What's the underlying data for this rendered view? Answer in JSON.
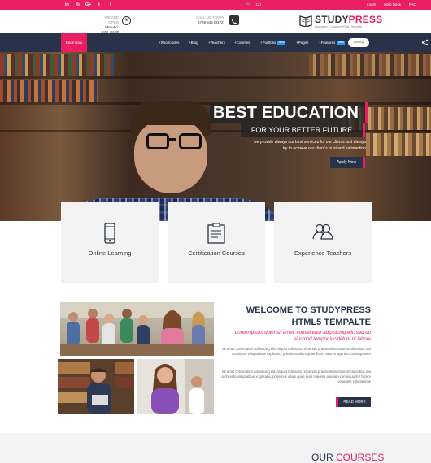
{
  "topbar": {
    "social": [
      "in",
      "◎",
      "G+",
      "t",
      "f"
    ],
    "cart": "(12)",
    "links": [
      "Login",
      "Help Desk",
      "FAQ"
    ]
  },
  "header": {
    "open_label": "WE ARE OPEN",
    "open_hours": "Mon-Fri: 8:00-18:00",
    "call_label": "CALL US TODAY",
    "call_number": "6789 345 (0172)",
    "logo_study": "STUDY",
    "logo_press": "PRESS",
    "logo_tagline": "Education & Courses HTML Template"
  },
  "nav": {
    "book": "Book Now",
    "items": [
      "+Shortcodes",
      "+Blog",
      "+Teachers",
      "+Courses",
      "+Portfolio",
      "+Pages",
      "+Features"
    ],
    "new_badge": "New",
    "search_placeholder": "Looking"
  },
  "hero": {
    "title": "BEST EDUCATION",
    "subtitle": "FOR YOUR BETTER FUTURE",
    "line1": "we provide always our best services for our clients and always",
    "line2": "try to achieve our client's trust and satisfaction",
    "cta": "Apply Now"
  },
  "features": [
    "Online Learning",
    "Certification Courses",
    "Experience Teachers"
  ],
  "welcome": {
    "title1": "WELCOME TO STUDYPRESS",
    "title2": "HTML5 TEMPALTE",
    "lead": "Lorem ipsum dolor sit amet, consectetur adipisicing elit, sed do eiusmod tempor incididunt ut labore",
    "p1": "Sit amet consectetur adipisicing elit. Aliquid nde iusto reiciendis praesentium dolorem doloribus nisi architecto voluptatibus explicabo, possimus ullam quae illum maiores aperiam consequuntur",
    "p2": "Sit amet consectetur adipisicing elit. Aliquid nde iusto reiciendis praesentium dolorem doloribus nisi architecto voluptatibus explicabo, possimus ullam quae illum maiores aperiam consequuntur facere voluptate voluptatibus",
    "readmore": "READ MORE"
  },
  "courses": {
    "our": "OUR ",
    "courses": "COURSES"
  },
  "colors": {
    "accent": "#e91e63",
    "navy": "#283248",
    "badge": "#2196f3"
  }
}
